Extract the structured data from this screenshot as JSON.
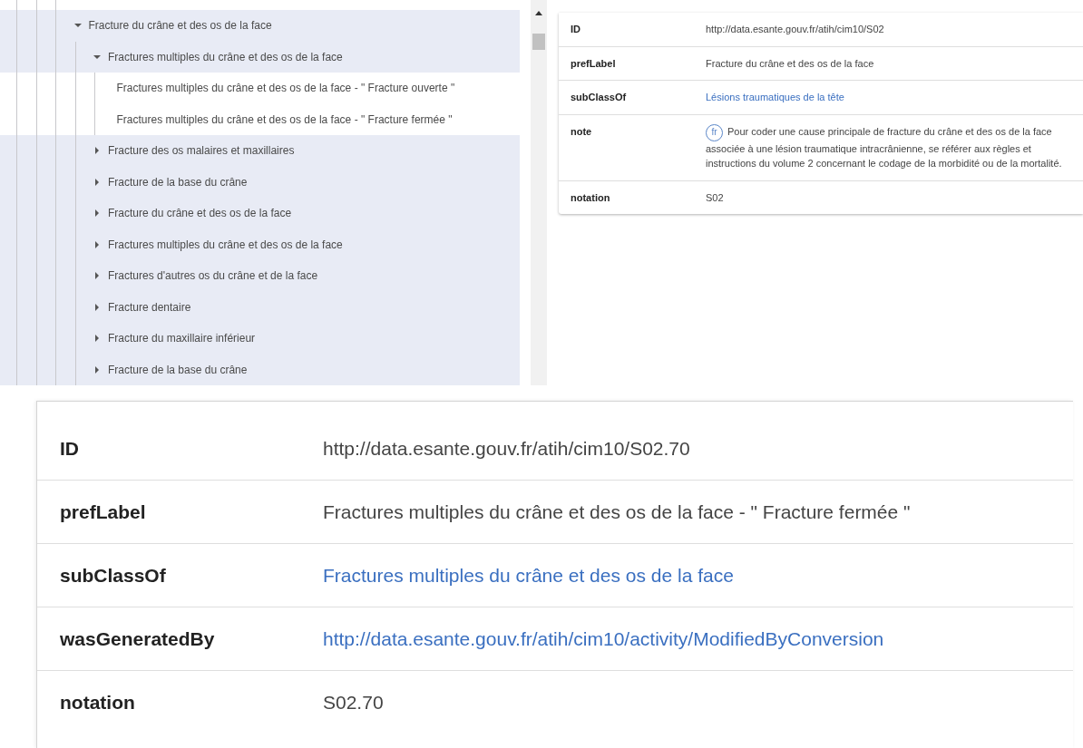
{
  "tree": [
    {
      "label": "Fracture du crâne et des os de la face",
      "kind": "branch",
      "expanded": true,
      "selected": true,
      "children": [
        {
          "label": "Fractures multiples du crâne et des os de la face",
          "kind": "branch",
          "expanded": true,
          "selected": true,
          "children": [
            {
              "label": "Fractures multiples du crâne et des os de la face - \" Fracture ouverte \"",
              "kind": "leaf",
              "selected": false
            },
            {
              "label": "Fractures multiples du crâne et des os de la face - \" Fracture fermée \"",
              "kind": "leaf",
              "selected": false
            }
          ]
        },
        {
          "label": "Fracture des os malaires et maxillaires",
          "kind": "branch",
          "expanded": false,
          "selected": true
        },
        {
          "label": "Fracture de la base du crâne",
          "kind": "branch",
          "expanded": false,
          "selected": true
        },
        {
          "label": "Fracture du crâne et des os de la face",
          "kind": "branch",
          "expanded": false,
          "selected": true
        },
        {
          "label": "Fractures multiples du crâne et des os de la face",
          "kind": "branch",
          "expanded": false,
          "selected": true
        },
        {
          "label": "Fractures d'autres os du crâne et de la face",
          "kind": "branch",
          "expanded": false,
          "selected": true
        },
        {
          "label": "Fracture dentaire",
          "kind": "branch",
          "expanded": false,
          "selected": true
        },
        {
          "label": "Fracture du maxillaire inférieur",
          "kind": "branch",
          "expanded": false,
          "selected": true
        },
        {
          "label": "Fracture de la base du crâne",
          "kind": "branch",
          "expanded": false,
          "selected": true
        }
      ]
    }
  ],
  "detail": [
    {
      "property": "ID",
      "kind": "text",
      "value": "http://data.esante.gouv.fr/atih/cim10/S02"
    },
    {
      "property": "prefLabel",
      "kind": "text",
      "value": "Fracture du crâne et des os de la face"
    },
    {
      "property": "subClassOf",
      "kind": "link",
      "value": "Lésions traumatiques de la tête"
    },
    {
      "property": "note",
      "kind": "note",
      "lang": "fr",
      "value": "Pour coder une cause principale de fracture du crâne et des os de la face associée à une lésion traumatique intracrânienne, se référer aux règles et instructions du volume 2 concernant le codage de la morbidité ou de la mortalité."
    },
    {
      "property": "notation",
      "kind": "text",
      "value": "S02"
    }
  ],
  "detail_zoomed": [
    {
      "property": "ID",
      "kind": "text",
      "value": "http://data.esante.gouv.fr/atih/cim10/S02.70"
    },
    {
      "property": "prefLabel",
      "kind": "text",
      "value": "Fractures multiples du crâne et des os de la face - \" Fracture fermée \""
    },
    {
      "property": "subClassOf",
      "kind": "link",
      "value": "Fractures multiples du crâne et des os de la face"
    },
    {
      "property": "wasGeneratedBy",
      "kind": "link",
      "value": "http://data.esante.gouv.fr/atih/cim10/activity/ModifiedByConversion"
    },
    {
      "property": "notation",
      "kind": "text",
      "value": "S02.70"
    }
  ]
}
